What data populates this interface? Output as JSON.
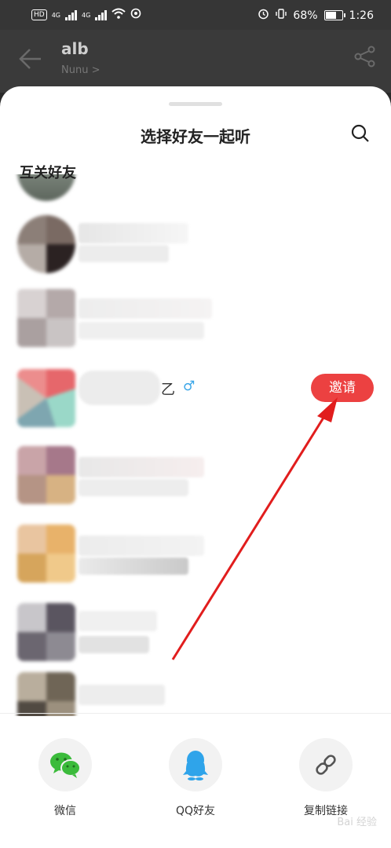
{
  "status_bar": {
    "hd_label": "HD",
    "net1": "4G",
    "net2": "4G",
    "battery_pct": "68%",
    "battery_level": 0.68,
    "time": "1:26"
  },
  "header": {
    "title": "alb",
    "subtitle": "Nunu >"
  },
  "sheet": {
    "title": "选择好友一起听",
    "section_title": "互关好友",
    "rows": [
      {
        "suffix": "",
        "gender": "",
        "invite": ""
      },
      {
        "suffix": "",
        "gender": "",
        "invite": ""
      },
      {
        "suffix": "",
        "gender": "",
        "invite": ""
      },
      {
        "suffix": "乙",
        "gender": "♂",
        "invite": "邀请"
      }
    ]
  },
  "share": {
    "wechat": "微信",
    "qq": "QQ好友",
    "copy_link": "复制链接"
  },
  "watermark": "Bai 经验",
  "colors": {
    "accent": "#ec4141",
    "wechat_green": "#3bbb3b",
    "qq_blue": "#2fa4ea"
  }
}
